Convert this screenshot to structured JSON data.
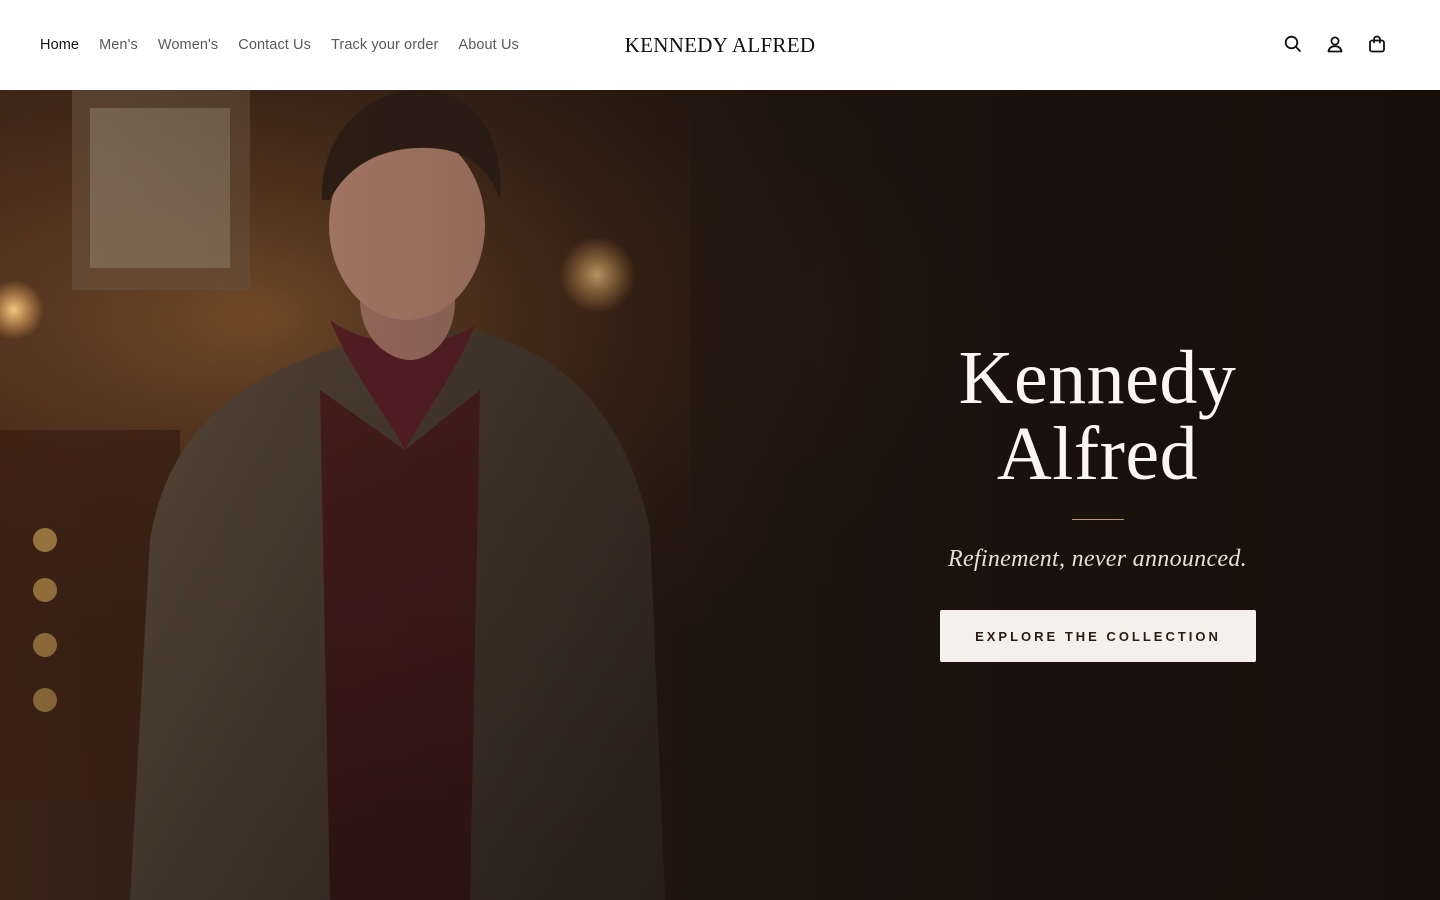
{
  "header": {
    "nav": [
      {
        "label": "Home",
        "active": true
      },
      {
        "label": "Men's",
        "active": false
      },
      {
        "label": "Women's",
        "active": false
      },
      {
        "label": "Contact Us",
        "active": false
      },
      {
        "label": "Track your order",
        "active": false
      },
      {
        "label": "About Us",
        "active": false
      }
    ],
    "logo": "KENNEDY ALFRED",
    "icons": [
      "search-icon",
      "account-icon",
      "cart-icon"
    ]
  },
  "hero": {
    "title_line1": "Kennedy",
    "title_line2": "Alfred",
    "tagline": "Refinement, never announced.",
    "cta_label": "EXPLORE THE COLLECTION",
    "image_subject": "man in tweed jacket and scarf in warm wood-paneled room"
  },
  "colors": {
    "header_bg": "#ffffff",
    "hero_bg": "#1f140e",
    "title_text": "#fbf7f0",
    "cta_bg": "#f4f0ea",
    "divider": "#b89a72"
  }
}
